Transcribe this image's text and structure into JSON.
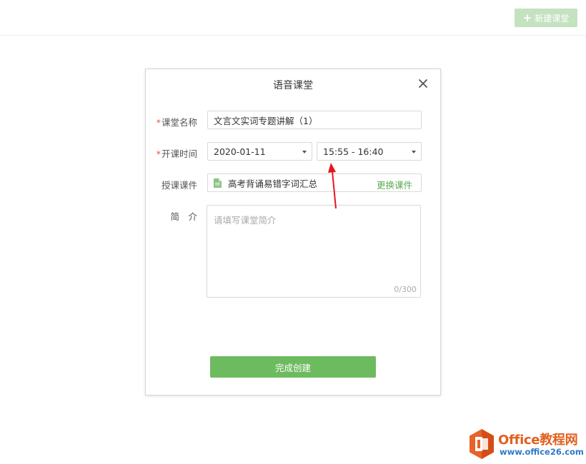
{
  "toolbar": {
    "new_class_label": "新建课堂",
    "new_class_icon": "plus-icon"
  },
  "dialog": {
    "title": "语音课堂",
    "close_icon": "close-icon",
    "fields": {
      "name": {
        "required_mark": "*",
        "label": "课堂名称",
        "value": "文言文实词专题讲解（1）"
      },
      "time": {
        "required_mark": "*",
        "label": "开课时间",
        "date_value": "2020-01-11",
        "time_value": "15:55 - 16:40"
      },
      "courseware": {
        "label": "授课课件",
        "file_icon": "document-icon",
        "value": "高考背诵易错字词汇总",
        "change_label": "更换课件"
      },
      "intro": {
        "label": "简　介",
        "placeholder": "请填写课堂简介",
        "counter": "0/300"
      }
    },
    "submit_label": "完成创建"
  },
  "colors": {
    "accent": "#6dbb5f",
    "accent_disabled": "#c4e2bf",
    "link": "#5aaa52",
    "required": "#e5534b",
    "annotation_arrow": "#e8151b"
  },
  "watermark": {
    "title": "Office教程网",
    "url": "www.office26.com"
  }
}
